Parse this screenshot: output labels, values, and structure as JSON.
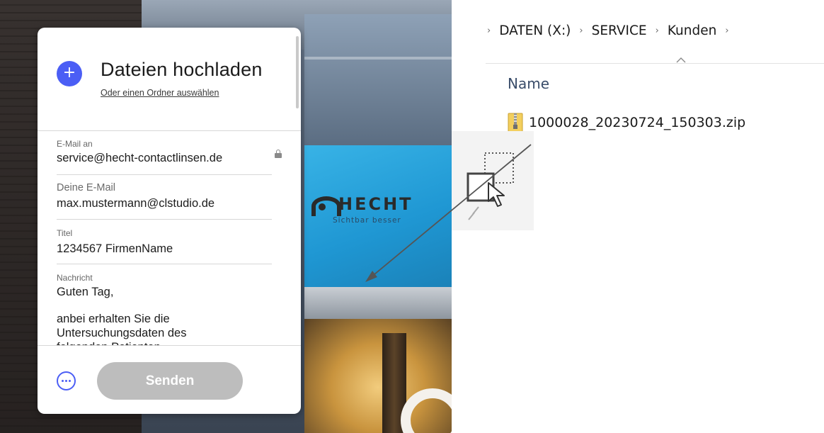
{
  "upload_panel": {
    "title": "Dateien hochladen",
    "folder_link": "Oder einen Ordner auswählen",
    "add_icon": "plus-icon",
    "fields": {
      "to": {
        "label": "E-Mail an",
        "value": "service@hecht-contactlinsen.de",
        "locked": true
      },
      "from": {
        "label": "Deine E-Mail",
        "value": "max.mustermann@clstudio.de"
      },
      "title": {
        "label": "Titel",
        "value": "1234567 FirmenName"
      },
      "message": {
        "label": "Nachricht",
        "greeting": "Guten Tag,",
        "body": "anbei erhalten Sie die Untersuchungsdaten des folgenden Patienten"
      }
    },
    "send_label": "Senden",
    "more_icon": "more-options-icon",
    "accent_color": "#4b5ef5",
    "send_button_color": "#bdbdbd"
  },
  "background_sign": {
    "brand": "HECHT",
    "tagline": "Sichtbar besser"
  },
  "explorer": {
    "breadcrumb": [
      "DATEN (X:)",
      "SERVICE",
      "Kunden"
    ],
    "separator": "›",
    "column_header": "Name",
    "files": [
      {
        "name": "1000028_20230724_150303.zip",
        "icon": "zip-folder-icon"
      }
    ]
  },
  "drag": {
    "cursor_icon": "drag-copy-cursor-icon",
    "arrow": "drag-arrow"
  }
}
